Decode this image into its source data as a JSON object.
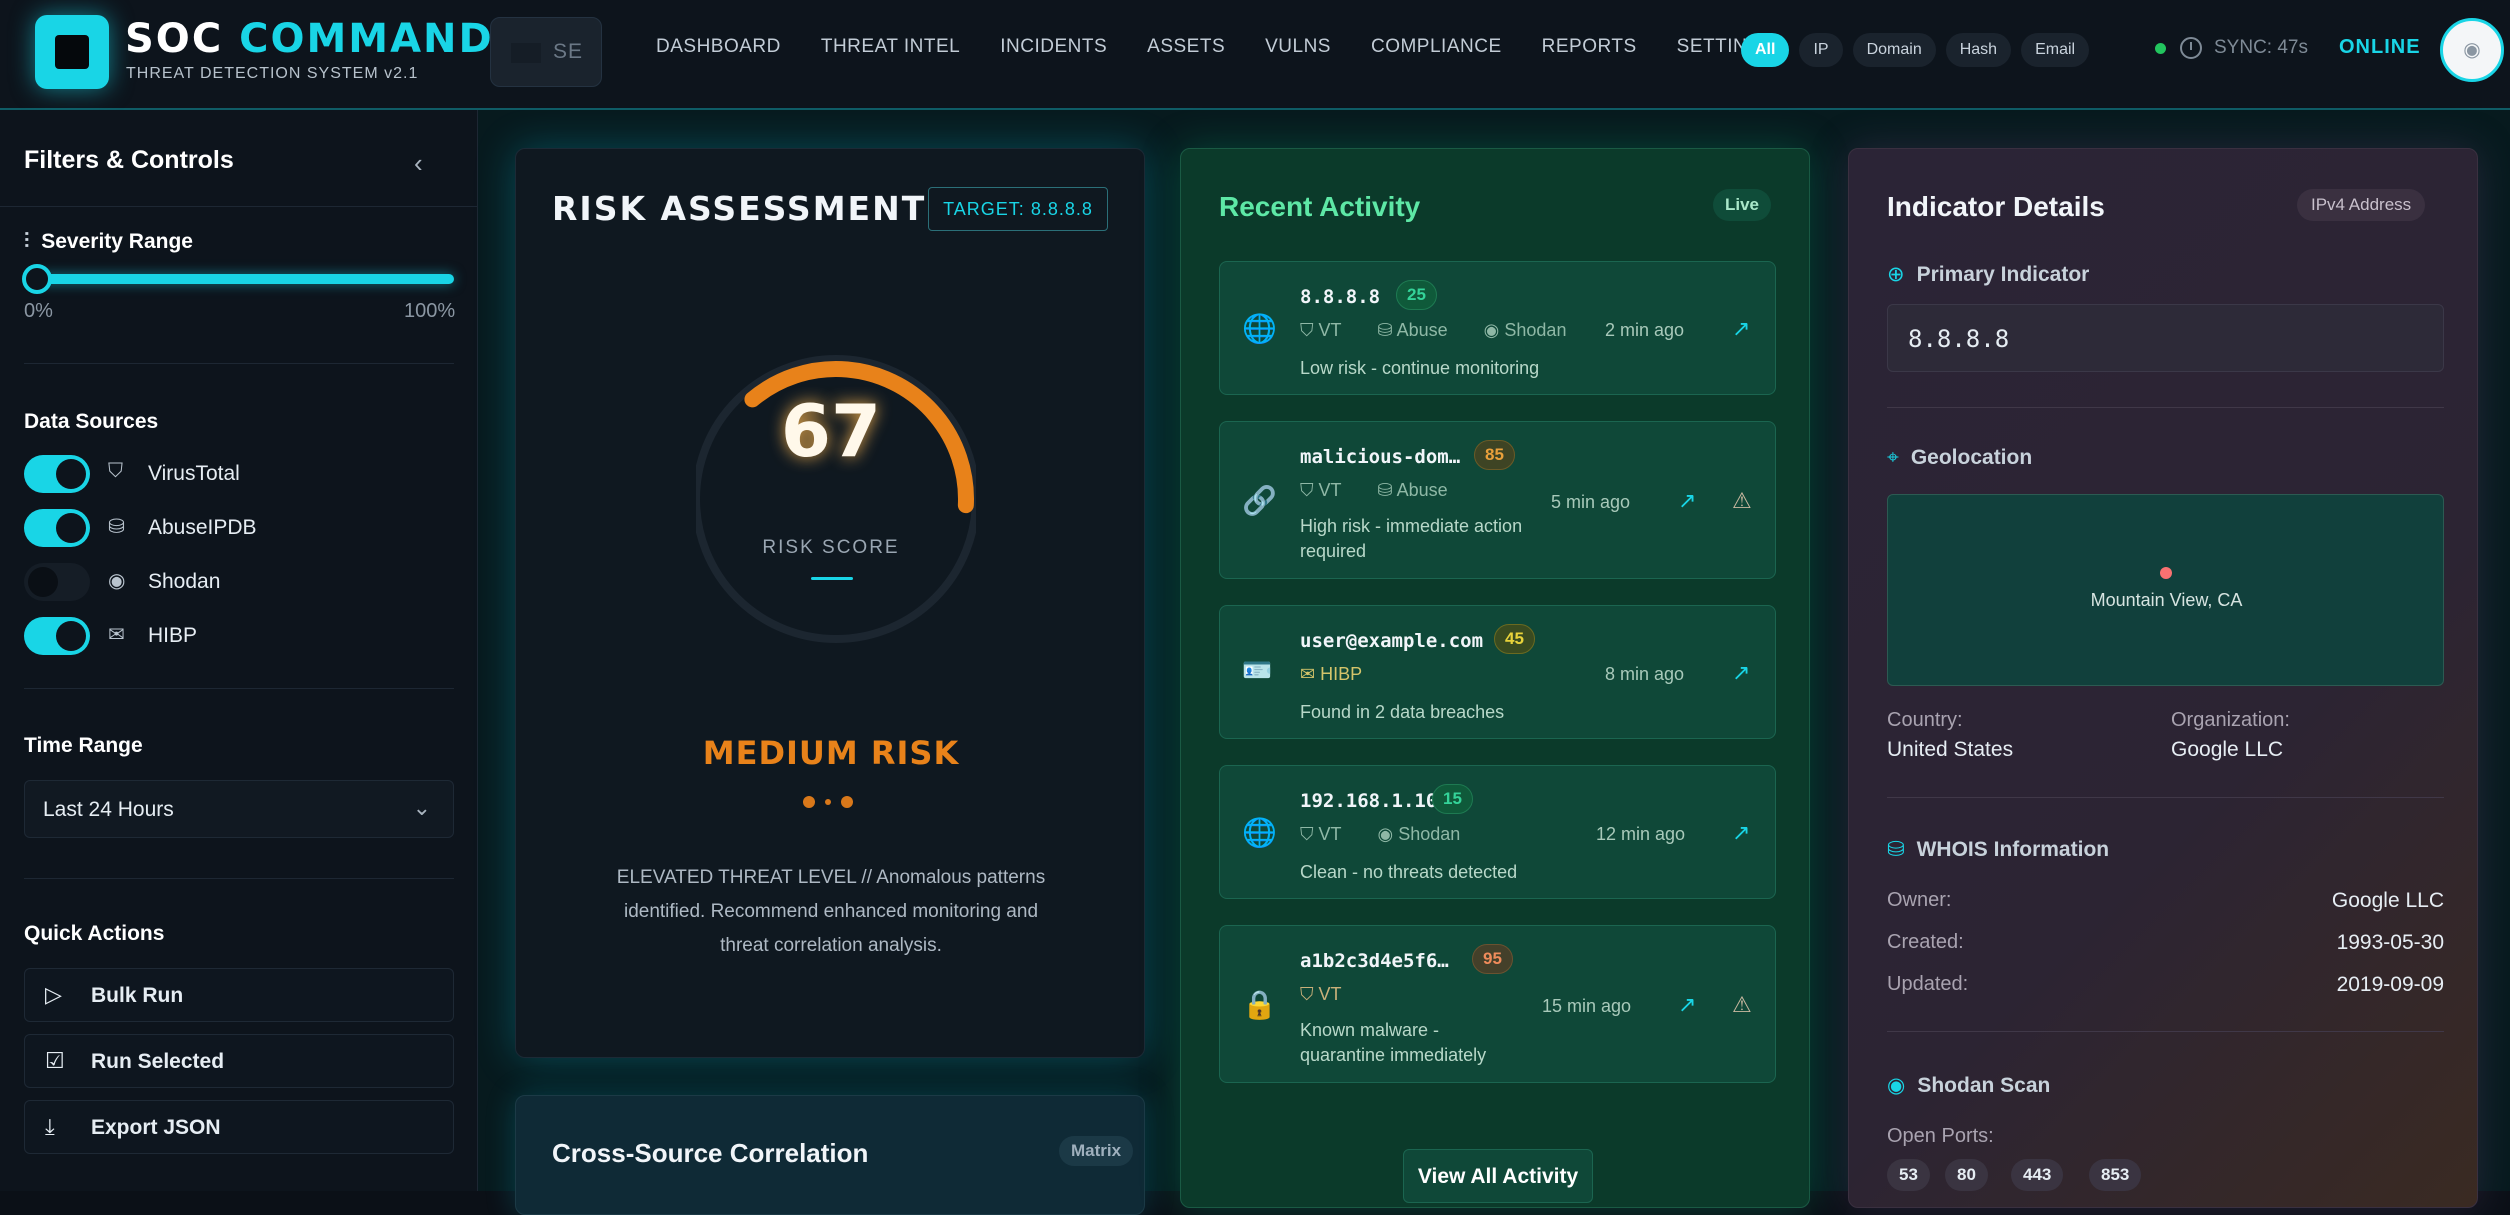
{
  "app": {
    "brand_main": "SOC ",
    "brand_accent": "COMMAND",
    "subtitle": "THREAT DETECTION SYSTEM v2.1",
    "search_text": "SE",
    "online": "ONLINE",
    "sync": "SYNC: 47s",
    "accent_color": "#19d5e6"
  },
  "nav": [
    "DASHBOARD",
    "THREAT INTEL",
    "INCIDENTS",
    "ASSETS",
    "VULNS",
    "COMPLIANCE",
    "REPORTS",
    "SETTINGS"
  ],
  "type_filters": [
    "All",
    "IP",
    "Domain",
    "Hash",
    "Email"
  ],
  "sidebar": {
    "title": "Filters & Controls",
    "severity": {
      "label": "Severity Range",
      "min": "0%",
      "max": "100%",
      "value": 0
    },
    "sources_title": "Data Sources",
    "sources": [
      {
        "label": "VirusTotal",
        "enabled": true,
        "icon": "shield-icon"
      },
      {
        "label": "AbuseIPDB",
        "enabled": true,
        "icon": "database-icon"
      },
      {
        "label": "Shodan",
        "enabled": false,
        "icon": "eye-icon"
      },
      {
        "label": "HIBP",
        "enabled": true,
        "icon": "mail-icon"
      }
    ],
    "time_title": "Time Range",
    "time_value": "Last 24 Hours",
    "actions_title": "Quick Actions",
    "actions": [
      "Bulk Run",
      "Run Selected",
      "Export JSON"
    ]
  },
  "risk": {
    "title": "RISK ASSESSMENT",
    "target": "TARGET: 8.8.8.8",
    "score": "67",
    "score_value": 67,
    "score_label": "RISK SCORE",
    "level": "MEDIUM RISK",
    "level_color": "#e8821a",
    "description": "ELEVATED THREAT LEVEL // Anomalous patterns identified. Recommend enhanced monitoring and threat correlation analysis."
  },
  "correlation": {
    "title": "Cross-Source Correlation",
    "badge": "Matrix"
  },
  "activity": {
    "title": "Recent Activity",
    "live": "Live",
    "view_all": "View All Activity",
    "items": [
      {
        "indicator": "8.8.8.8",
        "score": "25",
        "sources": [
          "VT",
          "Abuse",
          "Shodan"
        ],
        "time": "2 min ago",
        "desc": "Low risk - continue monitoring",
        "icon": "globe-icon"
      },
      {
        "indicator": "malicious-dom…",
        "score": "85",
        "sources": [
          "VT",
          "Abuse"
        ],
        "time": "5 min ago",
        "desc": "High risk - immediate action required",
        "icon": "link-icon"
      },
      {
        "indicator": "user@example.com",
        "score": "45",
        "sources": [
          "HIBP"
        ],
        "time": "8 min ago",
        "desc": "Found in 2 data breaches",
        "icon": "email-icon"
      },
      {
        "indicator": "192.168.1.100",
        "score": "15",
        "sources": [
          "VT",
          "Shodan"
        ],
        "time": "12 min ago",
        "desc": "Clean - no threats detected",
        "icon": "globe-icon"
      },
      {
        "indicator": "a1b2c3d4e5f6…",
        "score": "95",
        "sources": [
          "VT"
        ],
        "time": "15 min ago",
        "desc": "Known malware - quarantine immediately",
        "icon": "lock-icon"
      }
    ]
  },
  "details": {
    "title": "Indicator Details",
    "badge": "IPv4 Address",
    "primary_label": "Primary Indicator",
    "primary_value": "8.8.8.8",
    "geo_label": "Geolocation",
    "city": "Mountain View, CA",
    "country_k": "Country:",
    "country_v": "United States",
    "org_k": "Organization:",
    "org_v": "Google LLC",
    "whois_label": "WHOIS Information",
    "owner_k": "Owner:",
    "owner_v": "Google LLC",
    "created_k": "Created:",
    "created_v": "1993-05-30",
    "updated_k": "Updated:",
    "updated_v": "2019-09-09",
    "shodan_label": "Shodan Scan",
    "ports_k": "Open Ports:",
    "ports": [
      "53",
      "80",
      "443",
      "853"
    ]
  }
}
